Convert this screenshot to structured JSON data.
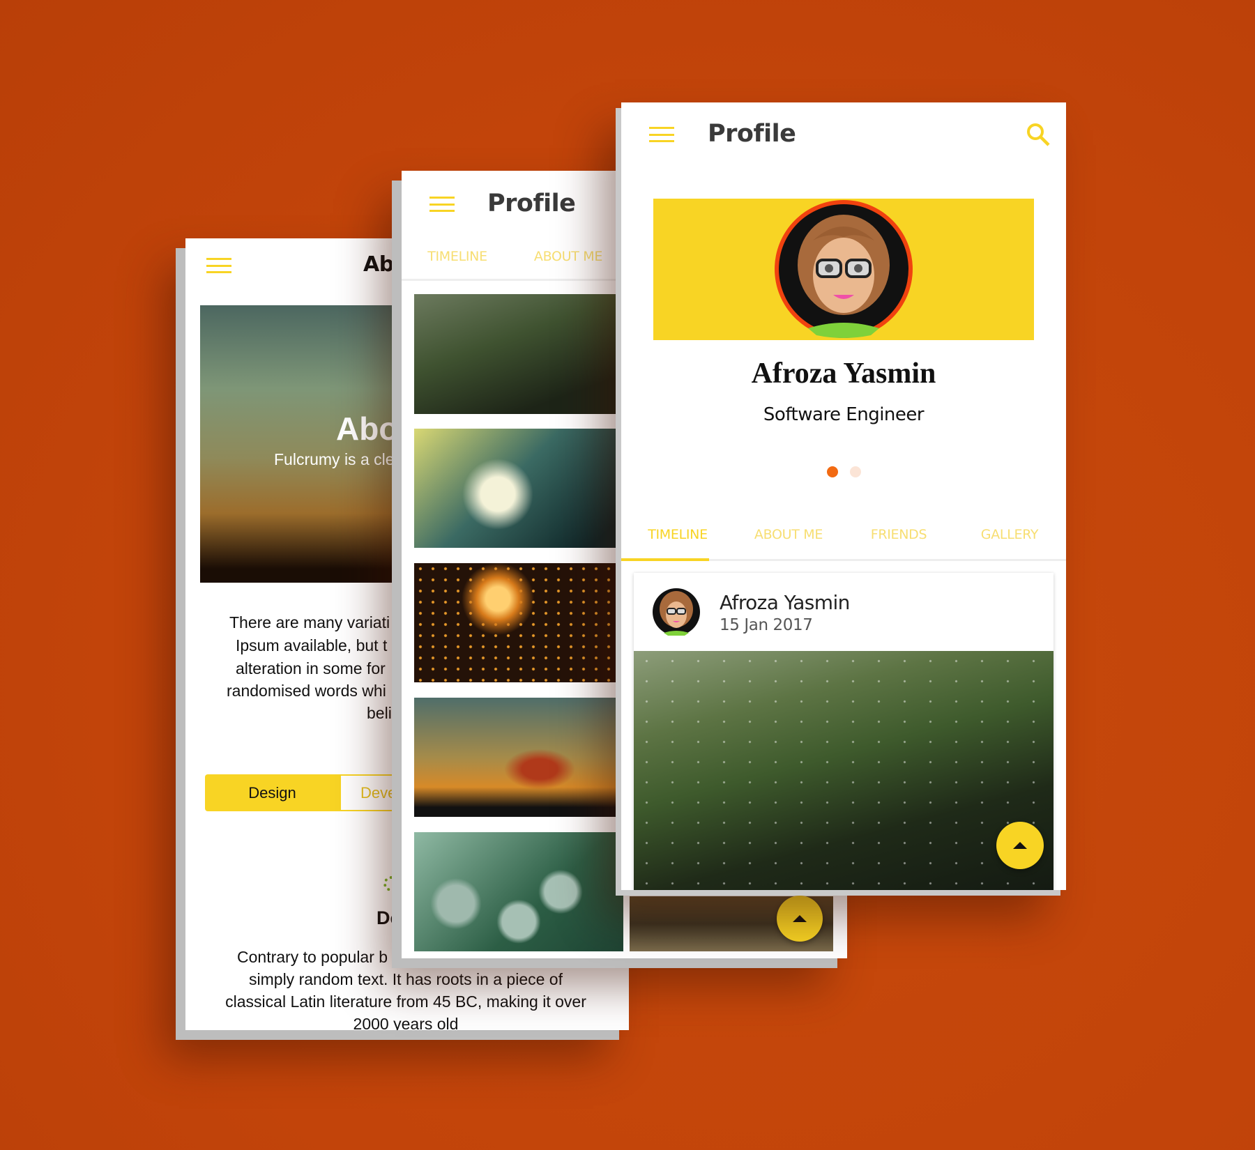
{
  "colors": {
    "background": "#c2440a",
    "accent": "#f8d424",
    "avatar_ring": "#f0420f"
  },
  "back_screen": {
    "title": "Abo",
    "hero_title": "Abo",
    "hero_subtitle": "Fulcrumy is a cle",
    "paragraph_lines": [
      "There are many variati",
      "Ipsum available, but t",
      "alteration in some for",
      "randomised words whi",
      "beli"
    ],
    "segments": {
      "design": "Design",
      "development": "Deve"
    },
    "section_title": "De",
    "bottom_lines": [
      "Contrary to popular b",
      "simply random text. It has roots in a piece of",
      "classical Latin literature from 45 BC, making it over",
      "2000 years old"
    ]
  },
  "middle_screen": {
    "title": "Profile",
    "tabs": [
      "TIMELINE",
      "ABOUT ME"
    ],
    "gallery": [
      "palm-leaves-photo",
      "daisy-photo",
      "sky-lanterns-photo",
      "umbrella-dancer-photo",
      "light-bulbs-photo",
      "country-road-photo"
    ]
  },
  "front_screen": {
    "title": "Profile",
    "profile_name": "Afroza Yasmin",
    "profile_role": "Software Engineer",
    "carousel": {
      "pages": 2,
      "active": 1
    },
    "tabs": [
      {
        "label": "TIMELINE",
        "active": true
      },
      {
        "label": "ABOUT ME",
        "active": false
      },
      {
        "label": "FRIENDS",
        "active": false
      },
      {
        "label": "GALLERY",
        "active": false
      }
    ],
    "post": {
      "author": "Afroza Yasmin",
      "date": "15 Jan 2017",
      "image": "palm-leaves-photo"
    }
  }
}
